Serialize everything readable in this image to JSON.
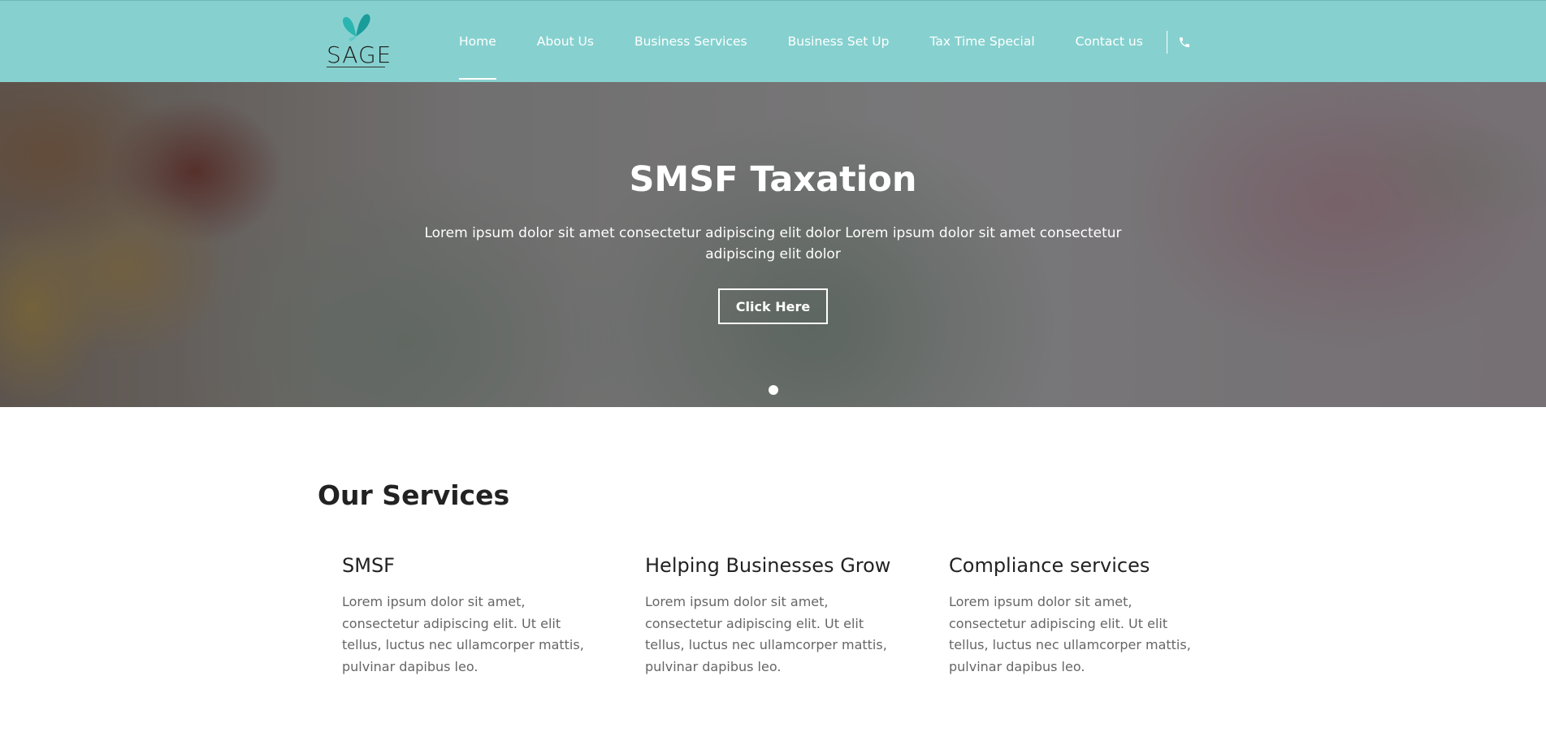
{
  "brand": {
    "name": "SAGE",
    "accent_color": "#86d1cf",
    "logo_icon": "butterfly-icon"
  },
  "nav": {
    "items": [
      {
        "label": "Home",
        "active": true
      },
      {
        "label": "About Us"
      },
      {
        "label": "Business Services"
      },
      {
        "label": "Business Set Up"
      },
      {
        "label": "Tax Time Special"
      },
      {
        "label": "Contact us"
      }
    ],
    "phone_icon": "phone-icon"
  },
  "hero": {
    "title": "SMSF Taxation",
    "text": "Lorem ipsum dolor sit amet consectetur adipiscing elit dolor Lorem ipsum dolor sit amet consectetur adipiscing elit dolor",
    "button_label": "Click Here",
    "slides_active": 1
  },
  "services": {
    "heading": "Our Services",
    "items": [
      {
        "title": "SMSF",
        "text": "Lorem ipsum dolor sit amet, consectetur adipiscing elit. Ut elit tellus, luctus nec ullamcorper mattis, pulvinar dapibus leo."
      },
      {
        "title": "Helping Businesses Grow",
        "text": "Lorem ipsum dolor sit amet, consectetur adipiscing elit. Ut elit tellus, luctus nec ullamcorper mattis, pulvinar dapibus leo."
      },
      {
        "title": "Compliance services",
        "text": "Lorem ipsum dolor sit amet, consectetur adipiscing elit. Ut elit tellus, luctus nec ullamcorper mattis, pulvinar dapibus leo."
      }
    ]
  }
}
